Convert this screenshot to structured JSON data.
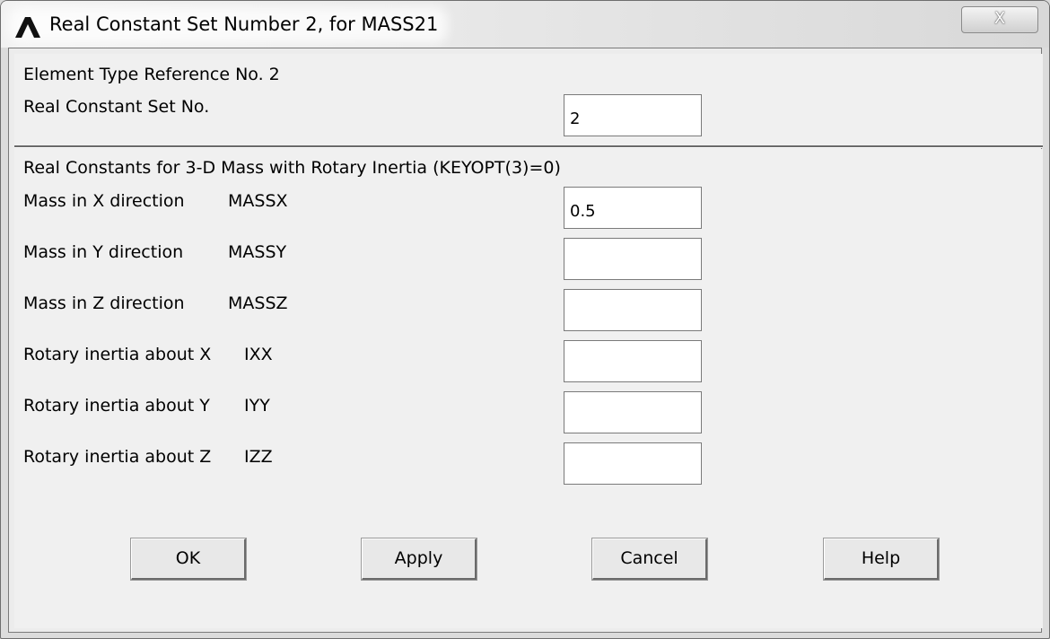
{
  "window": {
    "title": "Real Constant Set Number 2, for MASS21",
    "close_label": "X"
  },
  "header_section": {
    "element_type_ref": "Element Type Reference No. 2",
    "real_constant_set_label": "Real Constant Set No.",
    "real_constant_set_value": "2"
  },
  "constants_section": {
    "heading": "Real Constants for 3-D Mass with Rotary Inertia (KEYOPT(3)=0)",
    "rows": [
      {
        "label": "Mass in X direction",
        "key": "MASSX",
        "value": "0.5"
      },
      {
        "label": "Mass in Y direction",
        "key": "MASSY",
        "value": ""
      },
      {
        "label": "Mass in Z direction",
        "key": "MASSZ",
        "value": ""
      },
      {
        "label": "Rotary inertia about X",
        "key": "IXX",
        "value": ""
      },
      {
        "label": "Rotary inertia about Y",
        "key": "IYY",
        "value": ""
      },
      {
        "label": "Rotary inertia about Z",
        "key": "IZZ",
        "value": ""
      }
    ]
  },
  "buttons": {
    "ok": "OK",
    "apply": "Apply",
    "cancel": "Cancel",
    "help": "Help"
  }
}
